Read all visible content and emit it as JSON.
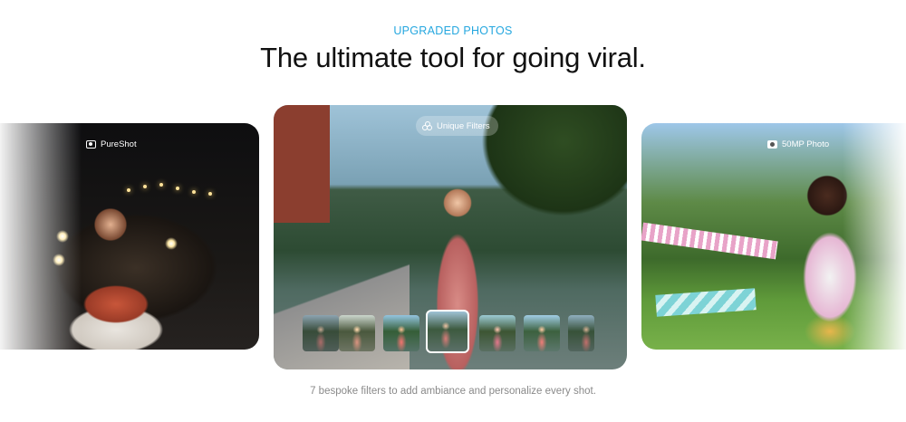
{
  "section": {
    "eyebrow": "UPGRADED PHOTOS",
    "headline": "The ultimate tool for going viral.",
    "caption": "7 bespoke filters to add ambiance and personalize every shot."
  },
  "cards": {
    "left": {
      "badge_label": "PureShot",
      "badge_icon": "pureshot-icon"
    },
    "center": {
      "badge_label": "Unique Filters",
      "badge_icon": "filters-icon",
      "filter_count": 7,
      "selected_filter_index": 3
    },
    "right": {
      "badge_label": "50MP Photo",
      "badge_icon": "camera-icon"
    }
  },
  "colors": {
    "accent": "#25a7df",
    "headline": "#111111",
    "caption": "#8a8a8a"
  }
}
